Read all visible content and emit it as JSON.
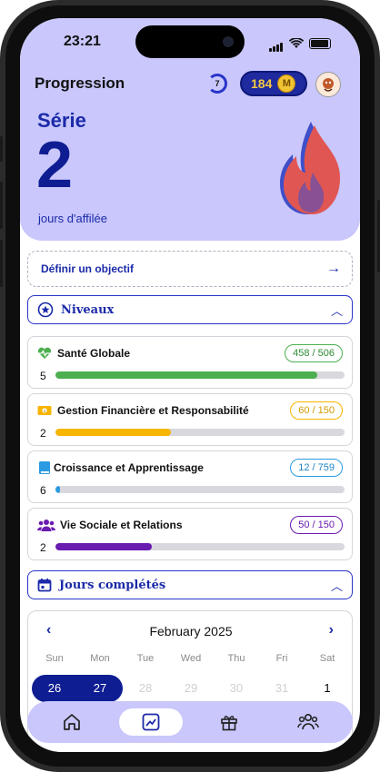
{
  "status_bar": {
    "time": "23:21"
  },
  "header": {
    "title": "Progression",
    "ring_value": "7",
    "coins": "184",
    "coin_letter": "M"
  },
  "streak": {
    "label": "Série",
    "count": "2",
    "caption": "jours d'affilée"
  },
  "goal": {
    "label": "Définir un objectif"
  },
  "levels_section": {
    "title": "Niveaux"
  },
  "levels": [
    {
      "name": "Santé Globale",
      "badge": "458 / 506",
      "level": "5",
      "progress": 0.905,
      "color": "#4caf50",
      "icon": "heartbeat-icon"
    },
    {
      "name": "Gestion Financière et Responsabilité",
      "badge": "60 / 150",
      "level": "2",
      "progress": 0.4,
      "color": "#f7b500",
      "icon": "money-icon"
    },
    {
      "name": "Croissance et Apprentissage",
      "badge": "12 / 759",
      "level": "6",
      "progress": 0.016,
      "color": "#2a9be0",
      "icon": "book-icon"
    },
    {
      "name": "Vie Sociale et Relations",
      "badge": "50 / 150",
      "level": "2",
      "progress": 0.333,
      "color": "#6a1bb0",
      "icon": "people-icon"
    }
  ],
  "days_section": {
    "title": "Jours complétés"
  },
  "calendar": {
    "month": "February 2025",
    "weekdays": [
      "Sun",
      "Mon",
      "Tue",
      "Wed",
      "Thu",
      "Fri",
      "Sat"
    ],
    "first_row": [
      "26",
      "27",
      "28",
      "29",
      "30",
      "31",
      "1"
    ]
  },
  "tabbar": {
    "items": [
      {
        "icon": "home-icon"
      },
      {
        "icon": "chart-icon",
        "active": true
      },
      {
        "icon": "gift-icon"
      },
      {
        "icon": "community-icon"
      }
    ]
  },
  "colors": {
    "header_bg": "#c9c7fb",
    "accent": "#1b2aa8",
    "accent_dark": "#0f1d93"
  }
}
